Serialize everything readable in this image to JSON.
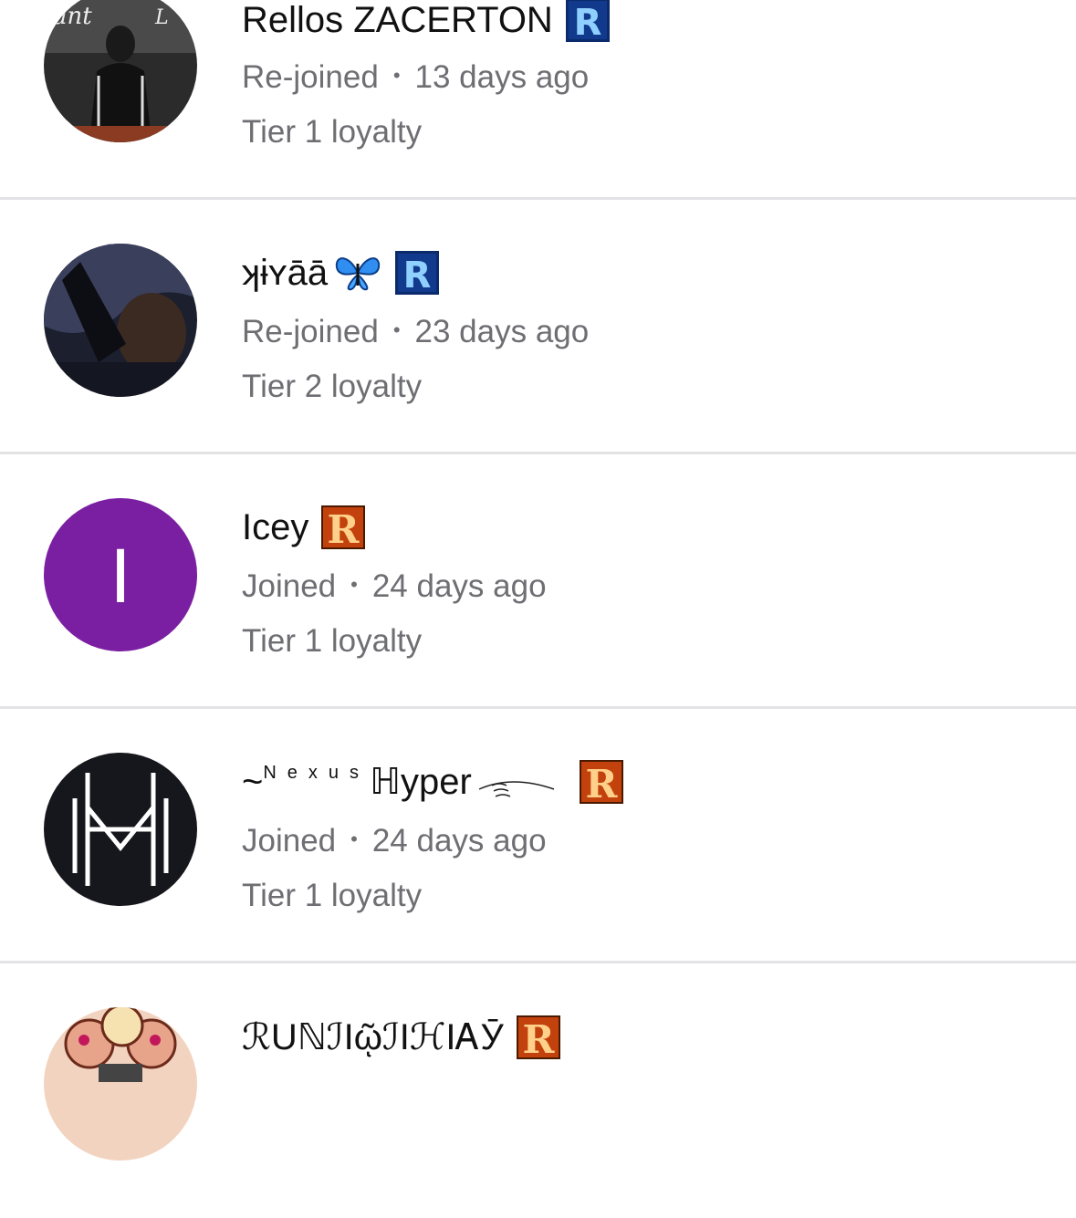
{
  "members": [
    {
      "name": "Rellos ZACERTON",
      "badge": "blue-r",
      "status": "Re-joined",
      "when": "13 days ago",
      "tier": "Tier 1 loyalty",
      "avatar": "photo-person-dark"
    },
    {
      "name": "ʞɨʏāā",
      "emoji": "butterfly",
      "badge": "blue-r",
      "status": "Re-joined",
      "when": "23 days ago",
      "tier": "Tier 2 loyalty",
      "avatar": "photo-selfie-dark"
    },
    {
      "name": "Icey",
      "badge": "fire-r",
      "status": "Joined",
      "when": "24 days ago",
      "tier": "Tier 1 loyalty",
      "avatar": "initial",
      "initial": "I",
      "avatar_color": "#7b1fa2"
    },
    {
      "name_prefix": "~",
      "name_small": "Nexus",
      "name_main": "ℍyper",
      "badge": "fire-r",
      "status": "Joined",
      "when": "24 days ago",
      "tier": "Tier 1 loyalty",
      "avatar": "logo-hm"
    },
    {
      "name": "ℛUℕℐIῷℐIℋIᎪӮ",
      "badge": "fire-r",
      "avatar": "cartoon"
    }
  ],
  "colors": {
    "divider": "#e3e3e6",
    "secondary_text": "#6e6e73",
    "primary_text": "#111111"
  }
}
